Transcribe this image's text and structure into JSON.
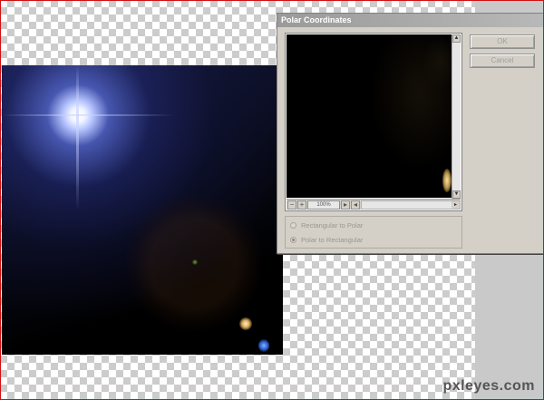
{
  "dialog": {
    "title": "Polar Coordinates",
    "ok_label": "OK",
    "cancel_label": "Cancel",
    "zoom": {
      "minus": "−",
      "plus": "+",
      "value": "100%"
    },
    "options": [
      {
        "label": "Rectangular to Polar",
        "selected": false
      },
      {
        "label": "Polar to Rectangular",
        "selected": true
      }
    ]
  },
  "watermark": "pxleyes.com",
  "colors": {
    "dialog_bg": "#d4d0c8",
    "title_bar": "#9a9a9a",
    "frame_border": "#d01010",
    "workspace_gray": "#c9c9c9"
  }
}
